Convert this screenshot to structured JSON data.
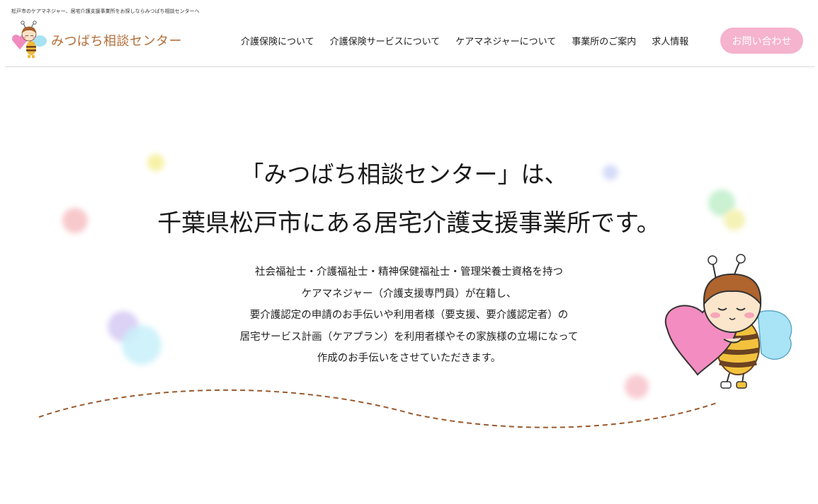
{
  "header": {
    "tagline": "松戸市のケアマネジャー、居宅介護支援事業所をお探しならみつばち相談センターへ",
    "logo_text": "みつばち相談センター",
    "nav": [
      "介護保険について",
      "介護保険サービスについて",
      "ケアマネジャーについて",
      "事業所のご案内",
      "求人情報"
    ],
    "contact_label": "お問い合わせ"
  },
  "hero": {
    "title_line1": "「みつばち相談センター」は、",
    "title_line2": "千葉県松戸市にある居宅介護支援事業所です。",
    "body": [
      "社会福祉士・介護福祉士・精神保健福祉士・管理栄養士資格を持つ",
      "ケアマネジャー（介護支援専門員）が在籍し、",
      "要介護認定の申請のお手伝いや利用者様（要支援、要介護認定者）の",
      "居宅サービス計画（ケアプラン）を利用者様やその家族様の立場になって",
      "作成のお手伝いをさせていただきます。"
    ]
  },
  "colors": {
    "brand_brown": "#b56e3a",
    "contact_pink": "#f5b3cd",
    "wave_brown": "#9a5a2e"
  },
  "icons": {
    "logo": "bee-mascot-icon",
    "mascot": "bee-hugging-heart-illustration"
  }
}
